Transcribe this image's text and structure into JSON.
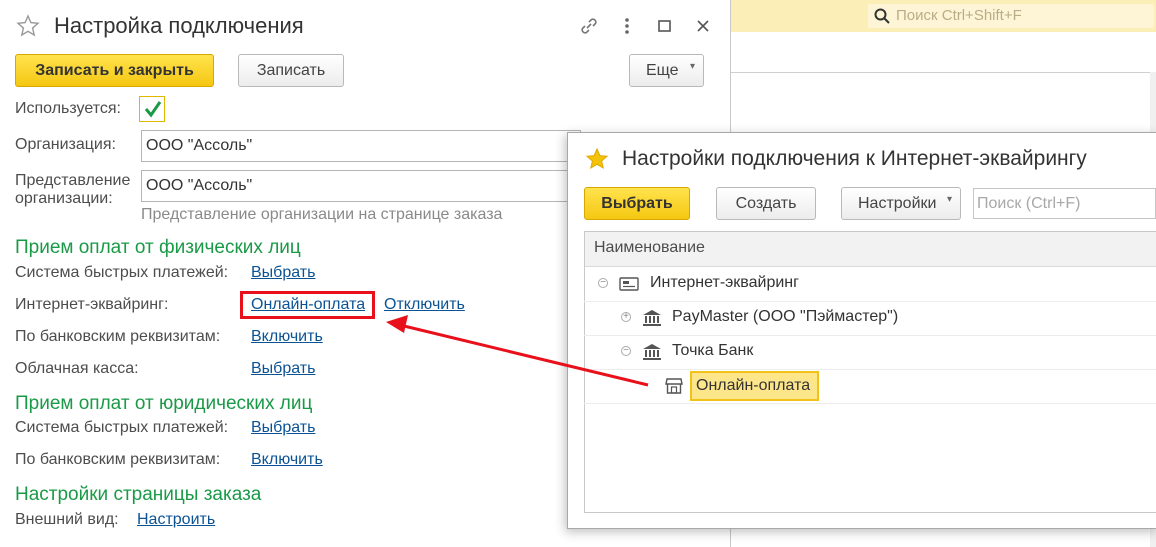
{
  "background": {
    "search_placeholder": "Поиск Ctrl+Shift+F"
  },
  "form": {
    "title": "Настройка подключения",
    "toolbar": {
      "save_close": "Записать и закрыть",
      "save": "Записать",
      "more": "Еще"
    },
    "used_label": "Используется:",
    "used_checked": true,
    "org_label": "Организация:",
    "org_value": "ООО \"Ассоль\"",
    "org_repr_label_line1": "Представление",
    "org_repr_label_line2": "организации:",
    "org_repr_value": "ООО \"Ассоль\"",
    "org_repr_hint": "Представление организации на странице заказа",
    "section_individuals": "Прием оплат от физических лиц",
    "individuals": [
      {
        "label": "Система быстрых платежей:",
        "link": "Выбрать"
      },
      {
        "label": "Интернет-эквайринг:",
        "link": "Онлайн-оплата",
        "link2": "Отключить"
      },
      {
        "label": "По банковским реквизитам:",
        "link": "Включить"
      },
      {
        "label": "Облачная касса:",
        "link": "Выбрать"
      }
    ],
    "section_legal": "Прием оплат от юридических лиц",
    "legal": [
      {
        "label": "Система быстрых платежей:",
        "link": "Выбрать"
      },
      {
        "label": "По банковским реквизитам:",
        "link": "Включить"
      }
    ],
    "section_order_page": "Настройки страницы заказа",
    "appearance_label": "Внешний вид:",
    "appearance_link": "Настроить"
  },
  "dialog": {
    "title": "Настройки подключения к Интернет-эквайрингу",
    "toolbar": {
      "select": "Выбрать",
      "create": "Создать",
      "settings": "Настройки",
      "search_placeholder": "Поиск (Ctrl+F)"
    },
    "column_header": "Наименование",
    "tree": {
      "root": "Интернет-эквайринг",
      "items": [
        {
          "label": "PayMaster (ООО \"Пэймастер\")",
          "expander": "+"
        },
        {
          "label": "Точка Банк",
          "expander": "−"
        }
      ],
      "selected_child": "Онлайн-оплата"
    }
  },
  "colors": {
    "accent_yellow": "#f5c712",
    "section_green": "#1a9a47",
    "link_blue": "#0b5394",
    "annotation_red": "#e8101b"
  }
}
